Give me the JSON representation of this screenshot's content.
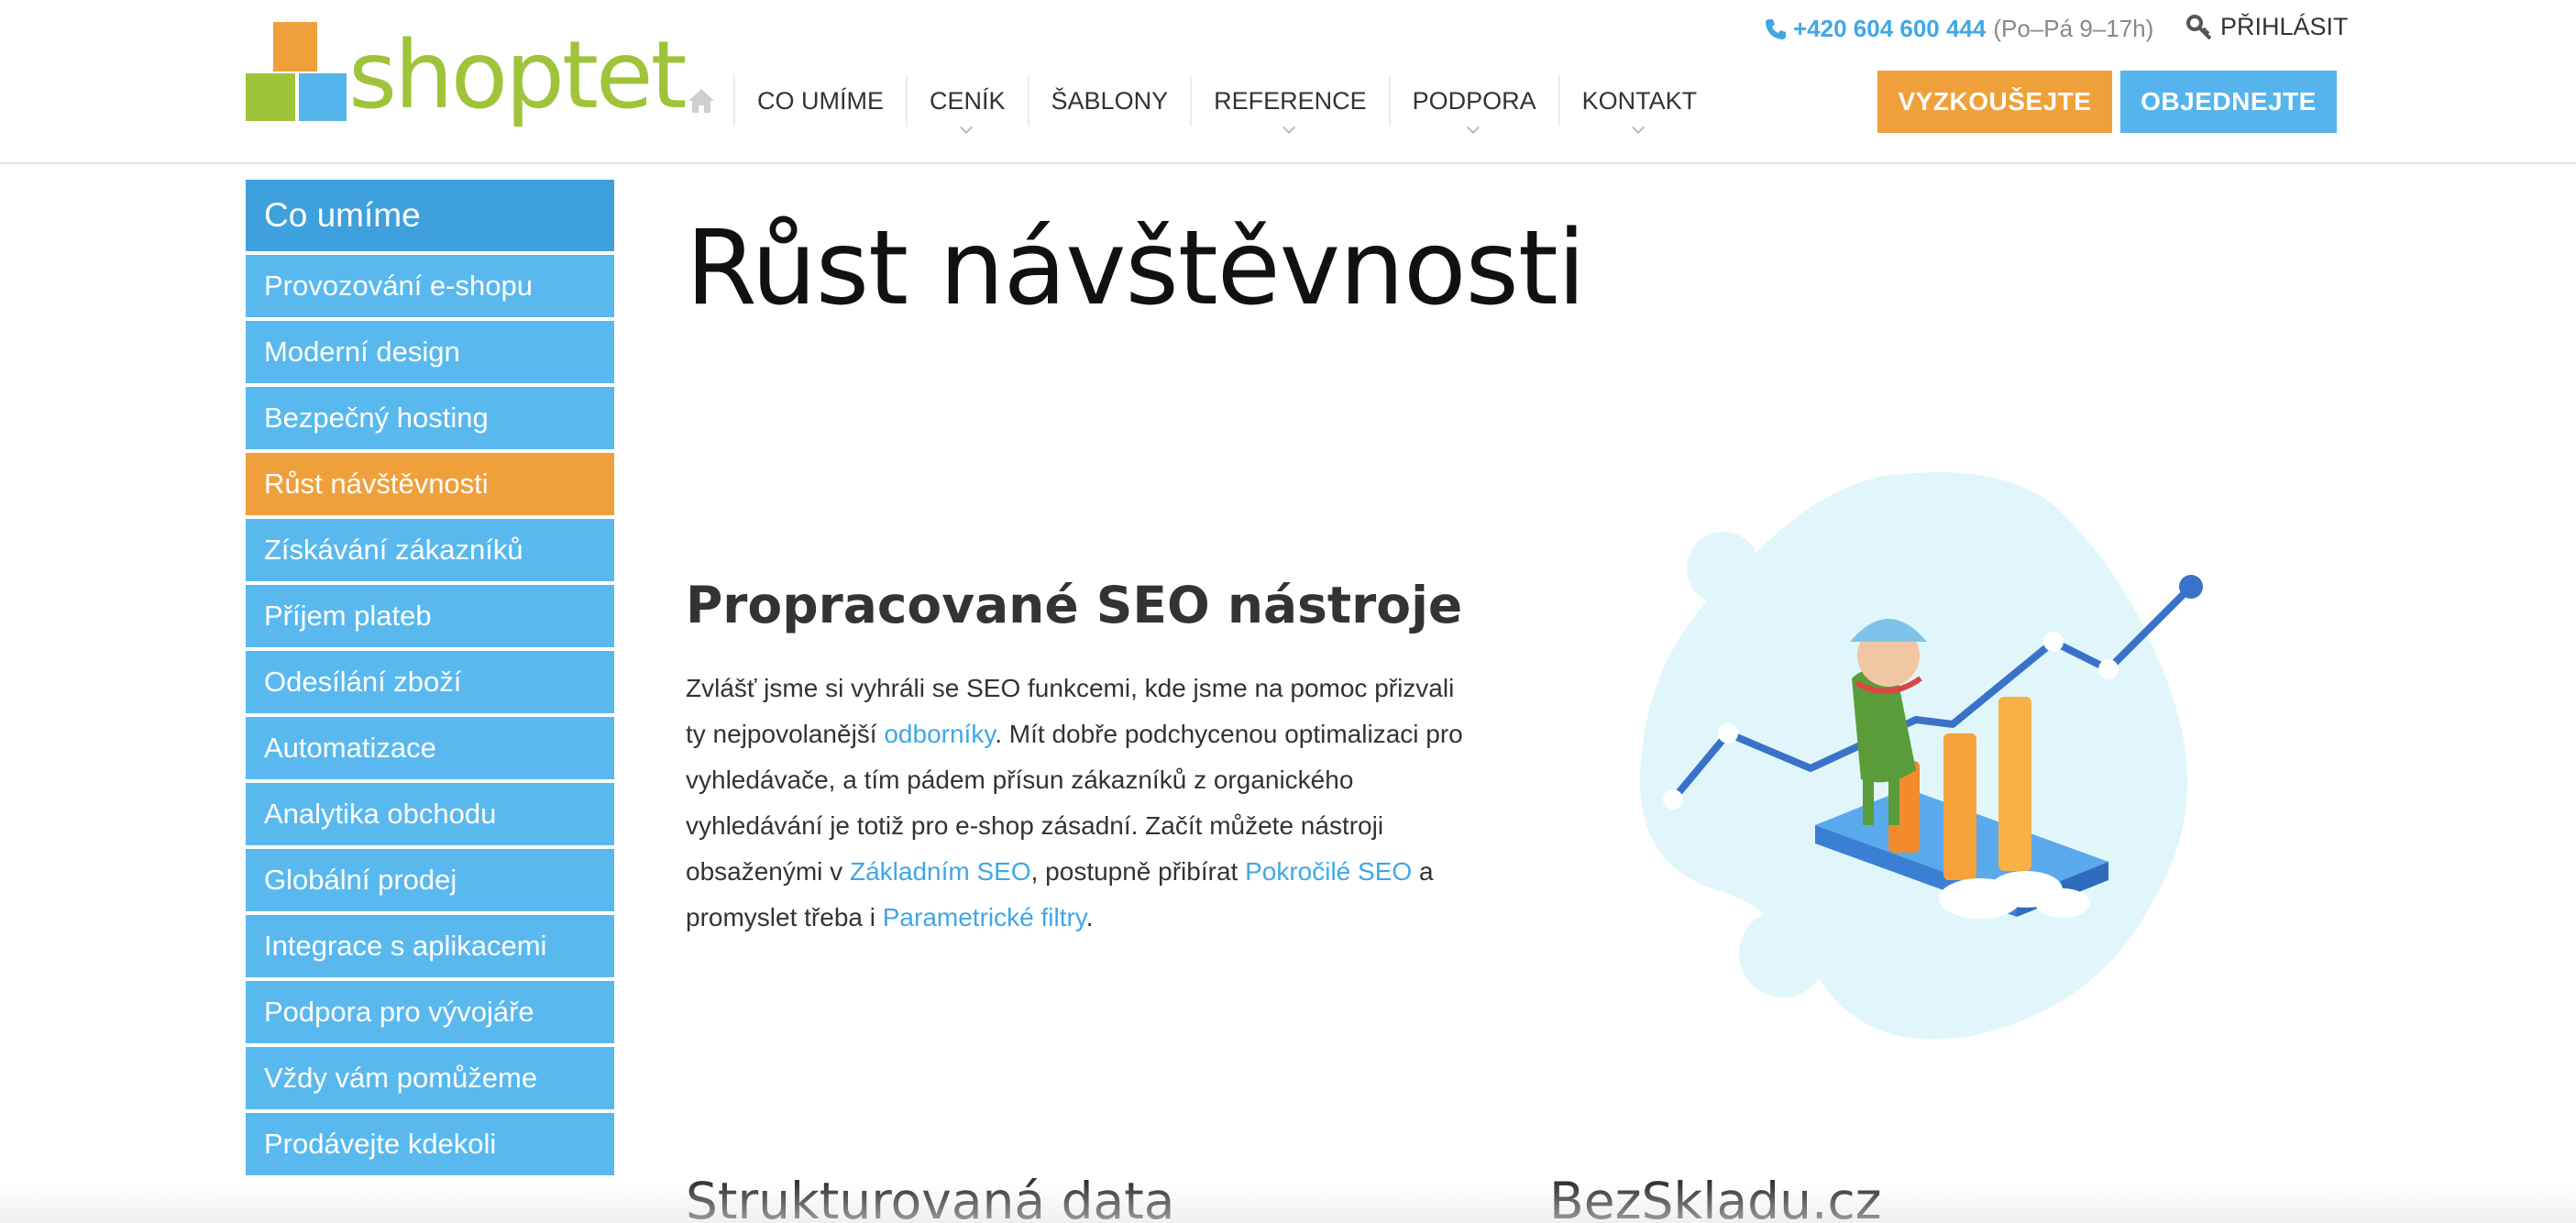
{
  "brand": {
    "name": "shoptet",
    "colors": {
      "orange": "#f0a03a",
      "blue": "#55b4ec",
      "green": "#9fc43a",
      "dark_blue": "#3fa0de"
    }
  },
  "header": {
    "nav": [
      {
        "label": "CO UMÍME",
        "has_dropdown": false
      },
      {
        "label": "CENÍK",
        "has_dropdown": true
      },
      {
        "label": "ŠABLONY",
        "has_dropdown": false
      },
      {
        "label": "REFERENCE",
        "has_dropdown": true
      },
      {
        "label": "PODPORA",
        "has_dropdown": true
      },
      {
        "label": "KONTAKT",
        "has_dropdown": true
      }
    ],
    "phone": "+420 604 600 444",
    "hours": "(Po–Pá 9–17h)",
    "login": "PŘIHLÁSIT",
    "try_button": "VYZKOUŠEJTE",
    "order_button": "OBJEDNEJTE"
  },
  "sidebar": {
    "heading": "Co umíme",
    "items": [
      {
        "label": "Provozování e-shopu",
        "active": false
      },
      {
        "label": "Moderní design",
        "active": false
      },
      {
        "label": "Bezpečný hosting",
        "active": false
      },
      {
        "label": "Růst návštěvnosti",
        "active": true
      },
      {
        "label": "Získávání zákazníků",
        "active": false
      },
      {
        "label": "Příjem plateb",
        "active": false
      },
      {
        "label": "Odesílání zboží",
        "active": false
      },
      {
        "label": "Automatizace",
        "active": false
      },
      {
        "label": "Analytika obchodu",
        "active": false
      },
      {
        "label": "Globální prodej",
        "active": false
      },
      {
        "label": "Integrace s aplikacemi",
        "active": false
      },
      {
        "label": "Podpora pro vývojáře",
        "active": false
      },
      {
        "label": "Vždy vám pomůžeme",
        "active": false
      },
      {
        "label": "Prodávejte kdekoli",
        "active": false
      }
    ]
  },
  "main": {
    "title": "Růst návštěvnosti",
    "section": {
      "title": "Propracované SEO nástroje",
      "text_1": "Zvlášť jsme si vyhráli se SEO funkcemi, kde jsme na pomoc přizvali ty nejpovolanější ",
      "link_1": "odborníky",
      "text_2": ". Mít dobře podchycenou optimalizaci pro vyhledávače, a tím pádem přísun zákazníků z organického vyhledávání je totiž pro e-shop zásadní. Začít můžete nástroji obsaženými v ",
      "link_2": "Základním SEO",
      "text_3": ", postupně přibírat ",
      "link_3": "Pokročilé SEO",
      "text_4": " a promyslet třeba i ",
      "link_4": "Parametrické filtry",
      "text_5": "."
    },
    "bottom_left_title": "Strukturovaná data",
    "bottom_right_title": "BezSkladu.cz"
  }
}
